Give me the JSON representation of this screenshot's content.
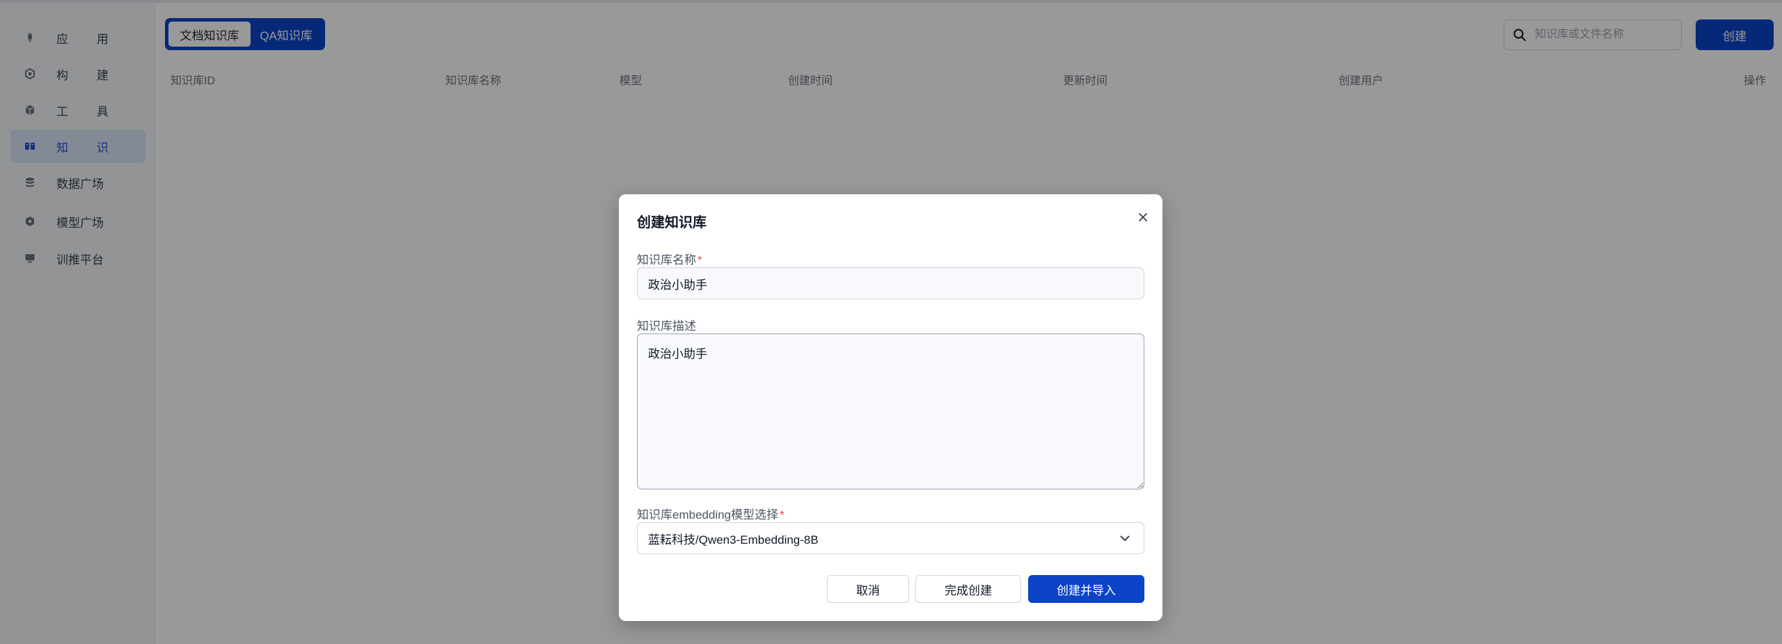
{
  "sidebar": {
    "items": [
      {
        "label": "应 用",
        "icon": "rocket-icon"
      },
      {
        "label": "构 建",
        "icon": "hexagon-build-icon"
      },
      {
        "label": "工 具",
        "icon": "cube-tool-icon"
      },
      {
        "label": "知 识",
        "icon": "book-icon",
        "active": true
      },
      {
        "label": "数据广场",
        "icon": "database-icon"
      },
      {
        "label": "模型广场",
        "icon": "model-cube-icon"
      },
      {
        "label": "训推平台",
        "icon": "monitor-icon"
      }
    ]
  },
  "header": {
    "tabs": [
      {
        "label": "文档知识库",
        "active": true
      },
      {
        "label": "QA知识库",
        "active": false
      }
    ],
    "search": {
      "placeholder": "知识库或文件名称",
      "value": ""
    },
    "create_label": "创建"
  },
  "table": {
    "columns": [
      "知识库ID",
      "知识库名称",
      "模型",
      "创建时间",
      "更新时间",
      "创建用户",
      "操作"
    ],
    "rows": []
  },
  "modal": {
    "title": "创建知识库",
    "name_label": "知识库名称",
    "name_value": "政治小助手",
    "desc_label": "知识库描述",
    "desc_value": "政治小助手",
    "model_label": "知识库embedding模型选择",
    "model_value": "蓝耘科技/Qwen3-Embedding-8B",
    "required_mark": "*",
    "cancel_label": "取消",
    "finish_label": "完成创建",
    "create_import_label": "创建并导入"
  },
  "colors": {
    "primary": "#0b44c8",
    "required": "#ef4444",
    "active_nav_bg": "#dbe6fb"
  }
}
